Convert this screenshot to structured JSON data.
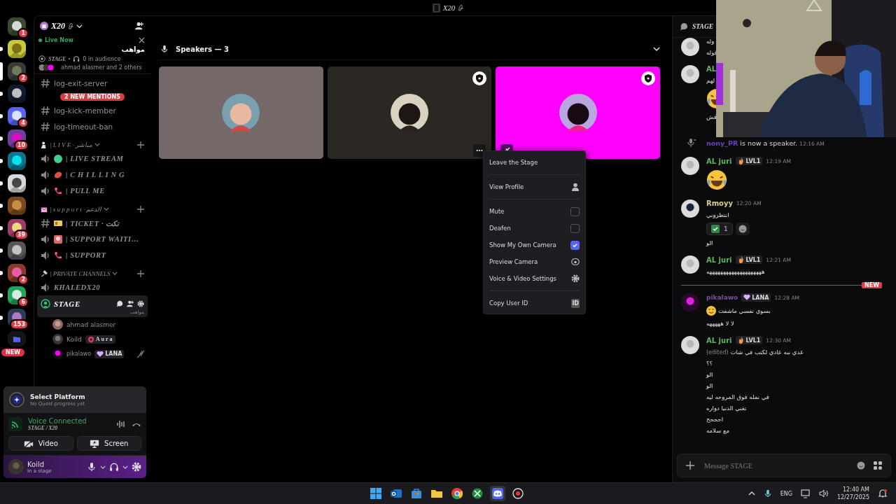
{
  "title_bar": {
    "title": "X20"
  },
  "servers": [
    {
      "badge": "1",
      "unread": false,
      "selected": false
    },
    {
      "unread": true,
      "selected": false
    },
    {
      "badge": "2",
      "unread": false,
      "selected": true
    },
    {
      "unread": true,
      "selected": false
    },
    {
      "badge": "4",
      "unread": true,
      "selected": false
    },
    {
      "badge": "10",
      "unread": true,
      "selected": false
    },
    {
      "unread": true,
      "selected": false
    },
    {
      "unread": true,
      "selected": false
    },
    {
      "unread": true,
      "selected": false
    },
    {
      "badge": "39",
      "unread": true,
      "selected": false
    },
    {
      "unread": true,
      "selected": false
    },
    {
      "badge": "2",
      "unread": true,
      "selected": false
    },
    {
      "badge": "6",
      "unread": true,
      "selected": false
    },
    {
      "badge": "153",
      "unread": true,
      "selected": false
    }
  ],
  "folder": {
    "badge": "NEW"
  },
  "server_header": {
    "name": "X20"
  },
  "live_now": {
    "label": "Live Now",
    "title": "مواهب",
    "stage": "STAGE",
    "audience": "0 in audience",
    "participants": "ahmad alasmer and 2 others"
  },
  "mentions_pill": "2 NEW MENTIONS",
  "channels": [
    {
      "kind": "text",
      "name": "log-exit-server",
      "selected": false
    },
    {
      "kind": "text",
      "name": "log-kick-member",
      "selected": false
    },
    {
      "kind": "text",
      "name": "log-timeout-ban",
      "selected": false
    },
    {
      "kind": "category",
      "name": "| L I V E · مباشر"
    },
    {
      "kind": "voice",
      "name": "| LIVE STREAM",
      "selected": false
    },
    {
      "kind": "voice",
      "name": "| C H I L L I N G",
      "selected": false
    },
    {
      "kind": "voice",
      "name": "| PULL ME",
      "selected": false
    },
    {
      "kind": "category",
      "name": "| s u p p o r t · الدعم"
    },
    {
      "kind": "text",
      "name": "| TICKET · تكت",
      "selected": false
    },
    {
      "kind": "voice",
      "name": "| SUPPORT WAITI…",
      "selected": false
    },
    {
      "kind": "voice",
      "name": "| SUPPORT",
      "selected": false
    },
    {
      "kind": "category",
      "name": "| PRIVATE CHANNELS"
    },
    {
      "kind": "voice",
      "name": "KHALEDX20",
      "selected": false
    },
    {
      "kind": "stage",
      "name": "STAGE",
      "subtitle": "مواهب",
      "selected": true
    }
  ],
  "members": [
    {
      "name": "ahmad alasmer",
      "muted": false
    },
    {
      "name": "Koild",
      "tag": {
        "kind": "aura",
        "label": "Aura"
      },
      "muted": false
    },
    {
      "name": "pikalawo",
      "tag": {
        "kind": "heart",
        "label": "LANA"
      },
      "muted": true
    }
  ],
  "quest": {
    "title": "Select Platform",
    "subtitle": "No Quest progress yet"
  },
  "voice_panel": {
    "status": "Voice Connected",
    "channel": "STAGE / X20",
    "buttons": [
      {
        "kind": "video",
        "label": "Video"
      },
      {
        "kind": "screen",
        "label": "Screen"
      }
    ]
  },
  "user": {
    "name": "Koild",
    "status": "In a stage"
  },
  "speakers": {
    "title": "Speakers — 3",
    "tiles": [
      {
        "color": "#756868",
        "moderator": false,
        "menu": false,
        "muted": false
      },
      {
        "color": "#2b2723",
        "moderator": true,
        "menu": true,
        "muted": false
      },
      {
        "color": "#ff00ff",
        "moderator": true,
        "menu": false,
        "muted": true
      }
    ]
  },
  "context_menu": [
    {
      "kind": "action",
      "label": "Leave the Stage"
    },
    {
      "kind": "divider"
    },
    {
      "kind": "profile",
      "label": "View Profile"
    },
    {
      "kind": "divider"
    },
    {
      "kind": "checkbox",
      "label": "Mute",
      "checked": false
    },
    {
      "kind": "checkbox",
      "label": "Deafen",
      "checked": false
    },
    {
      "kind": "checkbox",
      "label": "Show My Own Camera",
      "checked": true
    },
    {
      "kind": "preview",
      "label": "Preview Camera"
    },
    {
      "kind": "settings",
      "label": "Voice & Video Settings"
    },
    {
      "kind": "divider"
    },
    {
      "kind": "copy-id",
      "label": "Copy User ID",
      "icon_text": "ID"
    }
  ],
  "chat": {
    "channel": "STAGE",
    "messages": [
      {
        "kind": "message",
        "body": [
          {
            "kind": "text",
            "text": "وله"
          },
          {
            "kind": "text",
            "text": "قوله"
          }
        ]
      },
      {
        "kind": "message",
        "author": "AL",
        "color": "#5fb760",
        "body": [
          {
            "kind": "text",
            "text": "لهم"
          },
          {
            "kind": "sticker"
          },
          {
            "kind": "text",
            "text": "قش"
          }
        ]
      },
      {
        "kind": "system",
        "author": "nony_PR",
        "color": "#6a3fc9",
        "text": "is now a speaker.",
        "time": "12:16 AM"
      },
      {
        "kind": "message",
        "author": "AL juri",
        "color": "#5fb760",
        "tag": {
          "kind": "level",
          "label": "LVL1"
        },
        "time": "12:19 AM",
        "body": [
          {
            "kind": "sticker"
          }
        ]
      },
      {
        "kind": "message",
        "author": "Rmoyy",
        "color": "#d8cf8a",
        "time": "12:20 AM",
        "body": [
          {
            "kind": "text",
            "text": "انتظروني"
          },
          {
            "kind": "reactions",
            "count": "1",
            "selected": true
          },
          {
            "kind": "text",
            "text": "الو"
          }
        ]
      },
      {
        "kind": "message",
        "author": "AL juri",
        "color": "#5fb760",
        "tag": {
          "kind": "level",
          "label": "LVL1"
        },
        "time": "12:21 AM",
        "body": [
          {
            "kind": "text",
            "text": "ههههههههههههههههههههه"
          }
        ]
      },
      {
        "kind": "divider",
        "label": "NEW"
      },
      {
        "kind": "message",
        "author": "pikalawo",
        "color": "#7a4f9e",
        "tag": {
          "kind": "heart",
          "label": "LANA"
        },
        "time": "12:28 AM",
        "body": [
          {
            "kind": "text",
            "text": "بسوي نفسي ماشفت",
            "emoji": true
          },
          {
            "kind": "text",
            "text": "لا لا هههههه"
          }
        ]
      },
      {
        "kind": "message",
        "author": "AL juri",
        "color": "#5fb760",
        "tag": {
          "kind": "level",
          "label": "LVL1"
        },
        "time": "12:30 AM",
        "body": [
          {
            "kind": "text",
            "text": "عدي نبه عادي لكتب في شات",
            "edited": "(edited)"
          },
          {
            "kind": "text",
            "text": "؟؟"
          },
          {
            "kind": "text",
            "text": "الو"
          },
          {
            "kind": "text",
            "text": "الو"
          },
          {
            "kind": "text",
            "text": "في نمله فوق المروحه ليه"
          },
          {
            "kind": "text",
            "text": "تغني الدنيا دواره"
          },
          {
            "kind": "text",
            "text": "احححح"
          },
          {
            "kind": "text",
            "text": "مع سلامه"
          }
        ]
      }
    ],
    "composer": {
      "placeholder": "Message STAGE"
    }
  },
  "taskbar": {
    "apps": [
      {
        "kind": "start",
        "selected": false
      },
      {
        "kind": "outlook",
        "selected": false
      },
      {
        "kind": "store",
        "selected": false
      },
      {
        "kind": "files",
        "selected": false
      },
      {
        "kind": "chrome",
        "selected": false
      },
      {
        "kind": "xbox",
        "selected": false
      },
      {
        "kind": "discord",
        "selected": true
      },
      {
        "kind": "recorder",
        "selected": false
      }
    ],
    "language": "ENG",
    "time": "12:40 AM",
    "date": "12/27/2025"
  }
}
